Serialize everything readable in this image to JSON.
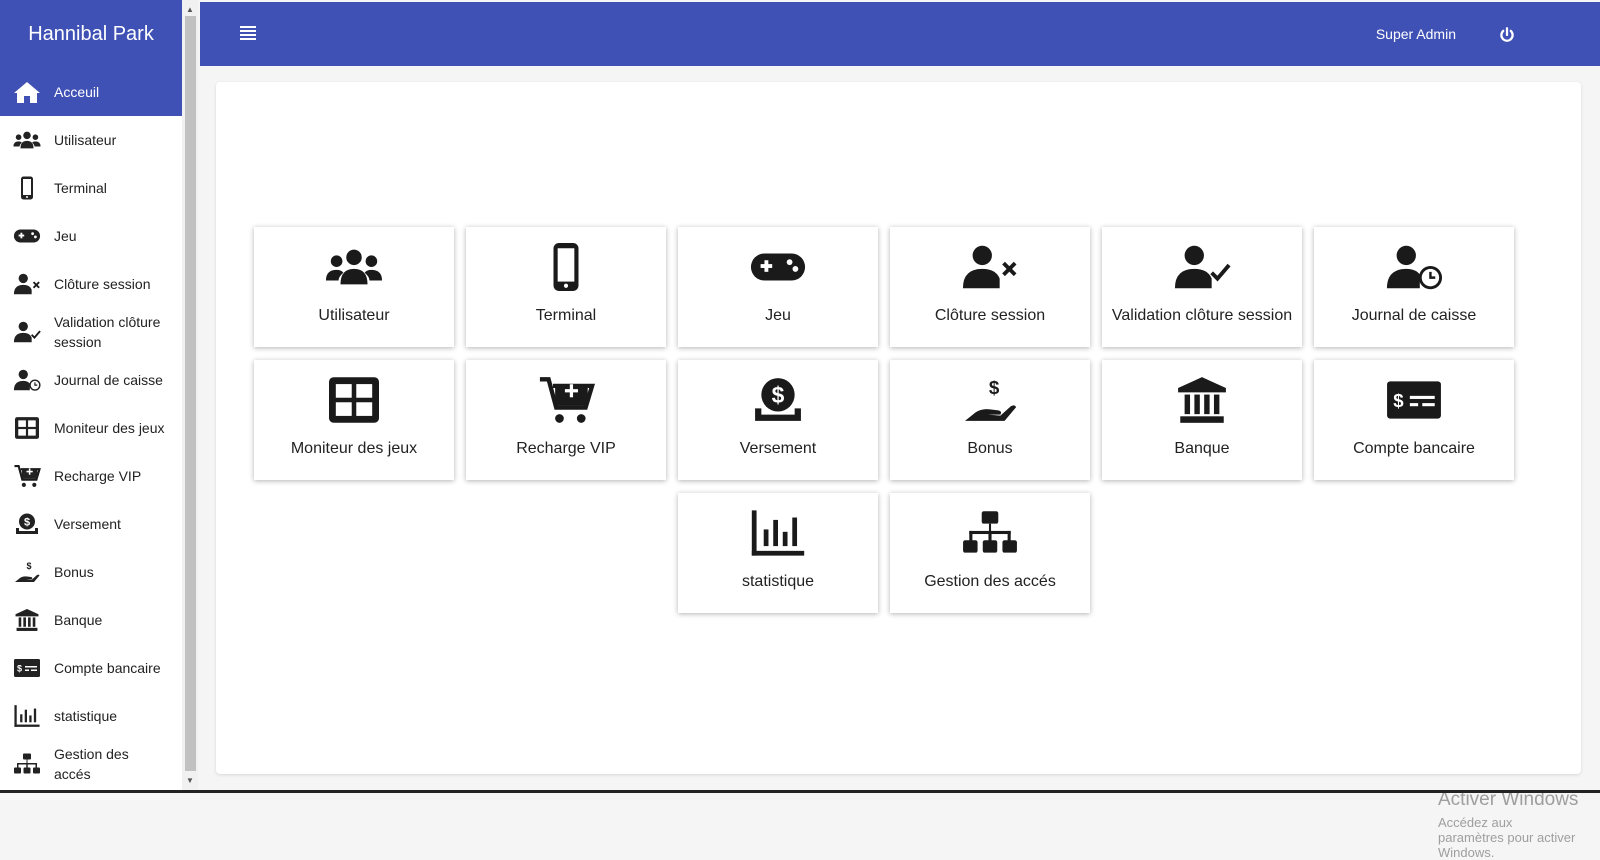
{
  "app": {
    "title": "Hannibal Park"
  },
  "header": {
    "user_name": "Super Admin"
  },
  "sidebar": {
    "items": [
      {
        "label": "Acceuil",
        "icon": "home-icon",
        "active": true
      },
      {
        "label": "Utilisateur",
        "icon": "users-icon"
      },
      {
        "label": "Terminal",
        "icon": "mobile-icon"
      },
      {
        "label": "Jeu",
        "icon": "gamepad-icon"
      },
      {
        "label": "Clôture session",
        "icon": "user-x-icon"
      },
      {
        "label": "Validation clôture session",
        "icon": "user-check-icon"
      },
      {
        "label": "Journal de caisse",
        "icon": "user-clock-icon"
      },
      {
        "label": "Moniteur des jeux",
        "icon": "grid-icon"
      },
      {
        "label": "Recharge VIP",
        "icon": "cart-plus-icon"
      },
      {
        "label": "Versement",
        "icon": "dollar-tray-icon"
      },
      {
        "label": "Bonus",
        "icon": "hand-dollar-icon"
      },
      {
        "label": "Banque",
        "icon": "bank-icon"
      },
      {
        "label": "Compte bancaire",
        "icon": "cheque-icon"
      },
      {
        "label": "statistique",
        "icon": "bar-chart-icon"
      },
      {
        "label": "Gestion des accés",
        "icon": "sitemap-icon"
      }
    ]
  },
  "tiles": [
    {
      "label": "Utilisateur",
      "icon": "users-icon"
    },
    {
      "label": "Terminal",
      "icon": "mobile-icon"
    },
    {
      "label": "Jeu",
      "icon": "gamepad-icon"
    },
    {
      "label": "Clôture session",
      "icon": "user-x-icon"
    },
    {
      "label": "Validation clôture session",
      "icon": "user-check-icon"
    },
    {
      "label": "Journal de caisse",
      "icon": "user-clock-icon"
    },
    {
      "label": "Moniteur des jeux",
      "icon": "grid-icon"
    },
    {
      "label": "Recharge VIP",
      "icon": "cart-plus-icon"
    },
    {
      "label": "Versement",
      "icon": "dollar-tray-icon"
    },
    {
      "label": "Bonus",
      "icon": "hand-dollar-icon"
    },
    {
      "label": "Banque",
      "icon": "bank-icon"
    },
    {
      "label": "Compte bancaire",
      "icon": "cheque-icon"
    },
    {
      "label": "statistique",
      "icon": "bar-chart-icon"
    },
    {
      "label": "Gestion des accés",
      "icon": "sitemap-icon"
    }
  ],
  "activation": {
    "title": "Activer Windows",
    "description": "Accédez aux paramètres pour activer Windows."
  },
  "colors": {
    "primary": "#3f51b5",
    "icon": "#1a1a1a",
    "background": "#f5f5f5"
  }
}
